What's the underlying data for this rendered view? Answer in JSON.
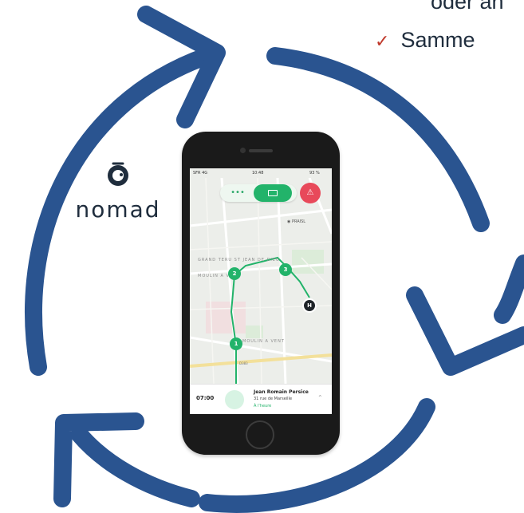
{
  "slide": {
    "line1": "oder an",
    "line2": "Samme",
    "check_glyph": "✓",
    "arrow_color": "#2a5490",
    "check_color": "#c0392b"
  },
  "logo": {
    "wordmark": "nomad",
    "icon": "nomad-logo-icon"
  },
  "phone": {
    "status": {
      "carrier": "SFR 4G",
      "time": "10:48",
      "battery": "93 %"
    },
    "map": {
      "labels": [
        "GRAND TERU ST JEAN DE DIEU",
        "MOULIN A VENT",
        "MOULIN A VENT",
        "GRAND..."
      ],
      "poi": "PRAISL",
      "stops": [
        "1",
        "2",
        "3"
      ],
      "end_marker": "H",
      "road_label": "D383"
    },
    "toolbar": {
      "route_icon": "route-icon",
      "map_icon": "map-icon",
      "alert_icon": "alert-icon",
      "alert_color": "#e8495a",
      "accent": "#22b36a"
    },
    "card": {
      "time": "07:00",
      "name": "Jean Romain Persice",
      "address": "31 rue de Marseille",
      "status": "À l'heure"
    }
  }
}
